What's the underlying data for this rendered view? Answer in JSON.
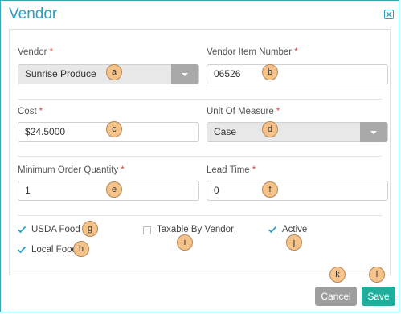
{
  "dialog": {
    "title": "Vendor"
  },
  "fields": {
    "vendor": {
      "label": "Vendor",
      "value": "Sunrise Produce"
    },
    "vendor_item_number": {
      "label": "Vendor Item Number",
      "value": "06526"
    },
    "cost": {
      "label": "Cost",
      "value": "$24.5000"
    },
    "unit_of_measure": {
      "label": "Unit Of Measure",
      "value": "Case"
    },
    "minimum_order_quantity": {
      "label": "Minimum Order Quantity",
      "value": "1"
    },
    "lead_time": {
      "label": "Lead Time",
      "value": "0"
    },
    "required_marker": "*"
  },
  "checkboxes": {
    "usda_food": {
      "label": "USDA Food",
      "checked": true
    },
    "local_food": {
      "label": "Local Food",
      "checked": true
    },
    "taxable_by_vendor": {
      "label": "Taxable By Vendor",
      "checked": false
    },
    "active": {
      "label": "Active",
      "checked": true
    }
  },
  "buttons": {
    "cancel": "Cancel",
    "save": "Save"
  },
  "badges": [
    "a",
    "b",
    "c",
    "d",
    "e",
    "f",
    "g",
    "h",
    "i",
    "j",
    "k",
    "l"
  ],
  "colors": {
    "title": "#2e9fc0",
    "save": "#1fae9b",
    "cancel": "#9e9e9e",
    "badge": "#f5c38a",
    "check": "#2e9fc0"
  }
}
